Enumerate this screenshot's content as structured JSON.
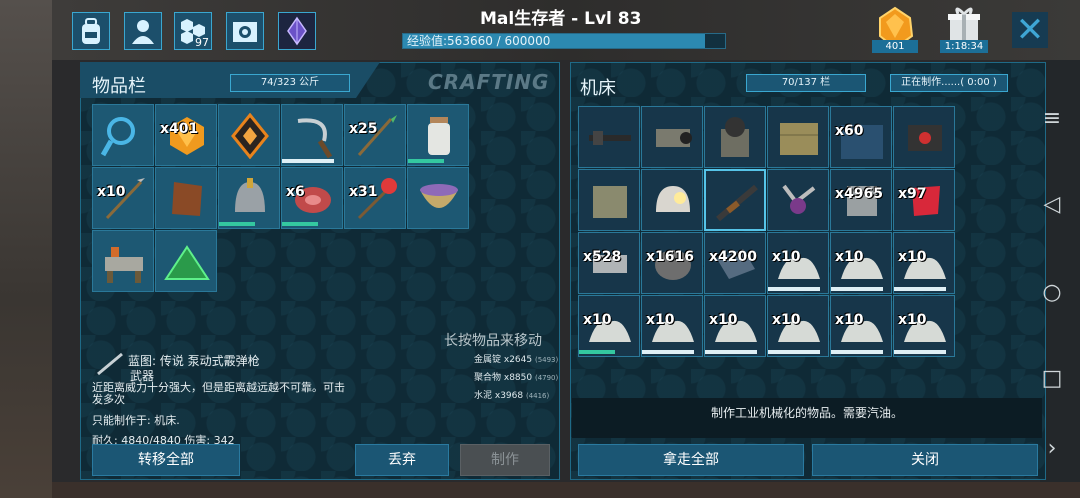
{
  "player": {
    "title": "Mal生存者 - Lvl 83",
    "xp_text": "经验值:563660 / 600000",
    "xp_fraction": 0.939
  },
  "topbar": {
    "icons": [
      "backpack-icon",
      "character-icon",
      "engram-icon",
      "settings-icon",
      "tribe-icon"
    ],
    "engram_points": "97",
    "gem_count": "401",
    "timer": "1:18:34"
  },
  "inventory": {
    "title": "物品栏",
    "weight": "74/323 公斤",
    "crafting_label": "CRAFTING",
    "slots": [
      {
        "icon": "magnifier-icon",
        "qty": ""
      },
      {
        "icon": "amber-icon",
        "qty": "x401"
      },
      {
        "icon": "element-shard-icon",
        "qty": ""
      },
      {
        "icon": "sickle-icon",
        "qty": "",
        "bar": "white"
      },
      {
        "icon": "spear-icon",
        "qty": "x25"
      },
      {
        "icon": "jar-icon",
        "qty": "",
        "bar": "green"
      },
      {
        "icon": "arrow-icon",
        "qty": "x10"
      },
      {
        "icon": "hide-icon",
        "qty": ""
      },
      {
        "icon": "helmet-icon",
        "qty": "",
        "bar": "green"
      },
      {
        "icon": "meat-icon",
        "qty": "x6",
        "bar": "green"
      },
      {
        "icon": "feather-arrow-icon",
        "qty": "x31"
      },
      {
        "icon": "mortar-icon",
        "qty": ""
      },
      {
        "icon": "workbench-icon",
        "qty": ""
      },
      {
        "icon": "tent-icon",
        "qty": ""
      }
    ],
    "hint": "长按物品来移动",
    "detail": {
      "name": "蓝图: 传说 泵动式霰弹枪",
      "category": "武器",
      "desc": "近距离威力十分强大，但是距离越远越不可靠。可击发多次",
      "craft_at": "只能制作于: 机床.",
      "stats": "耐久: 4840/4840  伤害: 342"
    },
    "resources": [
      {
        "label": "金属锭",
        "amt": "x2645",
        "have": "(5493)"
      },
      {
        "label": "聚合物",
        "amt": "x8850",
        "have": "(4790)"
      },
      {
        "label": "水泥",
        "amt": "x3968",
        "have": "(4416)"
      }
    ],
    "buttons": {
      "transfer_all": "转移全部",
      "drop": "丢弃",
      "craft": "制作"
    }
  },
  "machine": {
    "title": "机床",
    "slots_badge": "70/137 栏",
    "status_badge": "正在制作......( 0:00 )",
    "slots": [
      {
        "icon": "rifle-part-icon",
        "qty": ""
      },
      {
        "icon": "scope-icon",
        "qty": ""
      },
      {
        "icon": "gear-machine-icon",
        "qty": ""
      },
      {
        "icon": "mat-icon",
        "qty": ""
      },
      {
        "icon": "carpet-icon",
        "qty": "x60"
      },
      {
        "icon": "holo-scope-icon",
        "qty": ""
      },
      {
        "icon": "box-icon",
        "qty": ""
      },
      {
        "icon": "miner-helmet-icon",
        "qty": ""
      },
      {
        "icon": "shotgun-icon",
        "qty": "",
        "sel": true
      },
      {
        "icon": "flashlight-icon",
        "qty": ""
      },
      {
        "icon": "metal-icon",
        "qty": "x4965"
      },
      {
        "icon": "red-gem-icon",
        "qty": "x97"
      },
      {
        "icon": "ingot-icon",
        "qty": "x528"
      },
      {
        "icon": "stone-icon",
        "qty": "x1616"
      },
      {
        "icon": "slab-icon",
        "qty": "x4200"
      },
      {
        "icon": "paste-icon",
        "qty": "x10",
        "bar": "white"
      },
      {
        "icon": "paste-icon",
        "qty": "x10",
        "bar": "white"
      },
      {
        "icon": "paste-icon",
        "qty": "x10",
        "bar": "white"
      },
      {
        "icon": "paste-icon",
        "qty": "x10",
        "bar": "green"
      },
      {
        "icon": "paste-icon",
        "qty": "x10",
        "bar": "white"
      },
      {
        "icon": "paste-icon",
        "qty": "x10",
        "bar": "white"
      },
      {
        "icon": "paste-icon",
        "qty": "x10",
        "bar": "white"
      },
      {
        "icon": "paste-icon",
        "qty": "x10",
        "bar": "white"
      },
      {
        "icon": "paste-icon",
        "qty": "x10",
        "bar": "white"
      }
    ],
    "description": "制作工业机械化的物品。需要汽油。",
    "buttons": {
      "take_all": "拿走全部",
      "close": "关闭"
    }
  }
}
